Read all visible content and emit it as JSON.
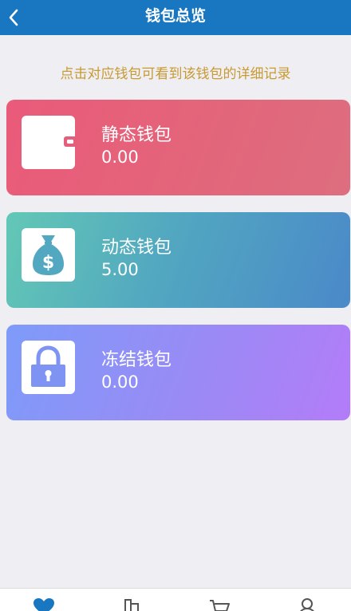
{
  "header": {
    "title": "钱包总览",
    "back_icon": "chevron-left-icon"
  },
  "hint": "点击对应钱包可看到该钱包的详细记录",
  "wallets": [
    {
      "name": "静态钱包",
      "amount": "0.00",
      "icon": "wallet-icon",
      "color": "#e45f7c"
    },
    {
      "name": "动态钱包",
      "amount": "5.00",
      "icon": "money-bag-icon",
      "color": "#52a8c0"
    },
    {
      "name": "冻结钱包",
      "amount": "0.00",
      "icon": "lock-icon",
      "color": "#9a8af5"
    }
  ],
  "bottom_nav": {
    "items": [
      {
        "icon": "heart-icon",
        "active": true
      },
      {
        "icon": "building-icon",
        "active": false
      },
      {
        "icon": "cart-icon",
        "active": false
      },
      {
        "icon": "user-icon",
        "active": false
      }
    ],
    "active_color": "#1877c0",
    "inactive_color": "#555555"
  }
}
